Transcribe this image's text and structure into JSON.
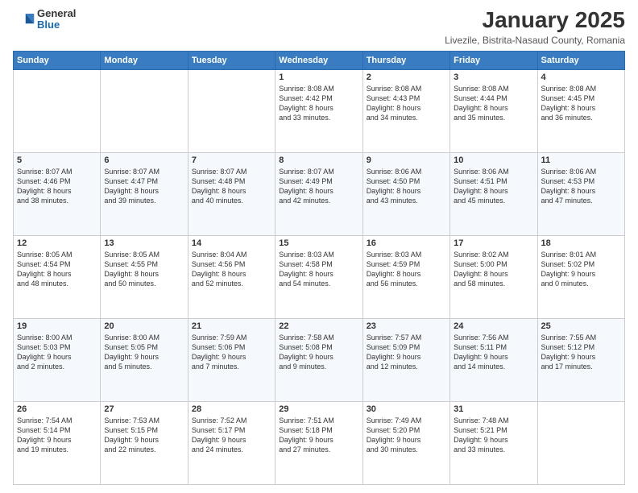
{
  "header": {
    "logo_general": "General",
    "logo_blue": "Blue",
    "month_title": "January 2025",
    "subtitle": "Livezile, Bistrita-Nasaud County, Romania"
  },
  "calendar": {
    "weekdays": [
      "Sunday",
      "Monday",
      "Tuesday",
      "Wednesday",
      "Thursday",
      "Friday",
      "Saturday"
    ],
    "weeks": [
      [
        {
          "day": "",
          "info": ""
        },
        {
          "day": "",
          "info": ""
        },
        {
          "day": "",
          "info": ""
        },
        {
          "day": "1",
          "info": "Sunrise: 8:08 AM\nSunset: 4:42 PM\nDaylight: 8 hours\nand 33 minutes."
        },
        {
          "day": "2",
          "info": "Sunrise: 8:08 AM\nSunset: 4:43 PM\nDaylight: 8 hours\nand 34 minutes."
        },
        {
          "day": "3",
          "info": "Sunrise: 8:08 AM\nSunset: 4:44 PM\nDaylight: 8 hours\nand 35 minutes."
        },
        {
          "day": "4",
          "info": "Sunrise: 8:08 AM\nSunset: 4:45 PM\nDaylight: 8 hours\nand 36 minutes."
        }
      ],
      [
        {
          "day": "5",
          "info": "Sunrise: 8:07 AM\nSunset: 4:46 PM\nDaylight: 8 hours\nand 38 minutes."
        },
        {
          "day": "6",
          "info": "Sunrise: 8:07 AM\nSunset: 4:47 PM\nDaylight: 8 hours\nand 39 minutes."
        },
        {
          "day": "7",
          "info": "Sunrise: 8:07 AM\nSunset: 4:48 PM\nDaylight: 8 hours\nand 40 minutes."
        },
        {
          "day": "8",
          "info": "Sunrise: 8:07 AM\nSunset: 4:49 PM\nDaylight: 8 hours\nand 42 minutes."
        },
        {
          "day": "9",
          "info": "Sunrise: 8:06 AM\nSunset: 4:50 PM\nDaylight: 8 hours\nand 43 minutes."
        },
        {
          "day": "10",
          "info": "Sunrise: 8:06 AM\nSunset: 4:51 PM\nDaylight: 8 hours\nand 45 minutes."
        },
        {
          "day": "11",
          "info": "Sunrise: 8:06 AM\nSunset: 4:53 PM\nDaylight: 8 hours\nand 47 minutes."
        }
      ],
      [
        {
          "day": "12",
          "info": "Sunrise: 8:05 AM\nSunset: 4:54 PM\nDaylight: 8 hours\nand 48 minutes."
        },
        {
          "day": "13",
          "info": "Sunrise: 8:05 AM\nSunset: 4:55 PM\nDaylight: 8 hours\nand 50 minutes."
        },
        {
          "day": "14",
          "info": "Sunrise: 8:04 AM\nSunset: 4:56 PM\nDaylight: 8 hours\nand 52 minutes."
        },
        {
          "day": "15",
          "info": "Sunrise: 8:03 AM\nSunset: 4:58 PM\nDaylight: 8 hours\nand 54 minutes."
        },
        {
          "day": "16",
          "info": "Sunrise: 8:03 AM\nSunset: 4:59 PM\nDaylight: 8 hours\nand 56 minutes."
        },
        {
          "day": "17",
          "info": "Sunrise: 8:02 AM\nSunset: 5:00 PM\nDaylight: 8 hours\nand 58 minutes."
        },
        {
          "day": "18",
          "info": "Sunrise: 8:01 AM\nSunset: 5:02 PM\nDaylight: 9 hours\nand 0 minutes."
        }
      ],
      [
        {
          "day": "19",
          "info": "Sunrise: 8:00 AM\nSunset: 5:03 PM\nDaylight: 9 hours\nand 2 minutes."
        },
        {
          "day": "20",
          "info": "Sunrise: 8:00 AM\nSunset: 5:05 PM\nDaylight: 9 hours\nand 5 minutes."
        },
        {
          "day": "21",
          "info": "Sunrise: 7:59 AM\nSunset: 5:06 PM\nDaylight: 9 hours\nand 7 minutes."
        },
        {
          "day": "22",
          "info": "Sunrise: 7:58 AM\nSunset: 5:08 PM\nDaylight: 9 hours\nand 9 minutes."
        },
        {
          "day": "23",
          "info": "Sunrise: 7:57 AM\nSunset: 5:09 PM\nDaylight: 9 hours\nand 12 minutes."
        },
        {
          "day": "24",
          "info": "Sunrise: 7:56 AM\nSunset: 5:11 PM\nDaylight: 9 hours\nand 14 minutes."
        },
        {
          "day": "25",
          "info": "Sunrise: 7:55 AM\nSunset: 5:12 PM\nDaylight: 9 hours\nand 17 minutes."
        }
      ],
      [
        {
          "day": "26",
          "info": "Sunrise: 7:54 AM\nSunset: 5:14 PM\nDaylight: 9 hours\nand 19 minutes."
        },
        {
          "day": "27",
          "info": "Sunrise: 7:53 AM\nSunset: 5:15 PM\nDaylight: 9 hours\nand 22 minutes."
        },
        {
          "day": "28",
          "info": "Sunrise: 7:52 AM\nSunset: 5:17 PM\nDaylight: 9 hours\nand 24 minutes."
        },
        {
          "day": "29",
          "info": "Sunrise: 7:51 AM\nSunset: 5:18 PM\nDaylight: 9 hours\nand 27 minutes."
        },
        {
          "day": "30",
          "info": "Sunrise: 7:49 AM\nSunset: 5:20 PM\nDaylight: 9 hours\nand 30 minutes."
        },
        {
          "day": "31",
          "info": "Sunrise: 7:48 AM\nSunset: 5:21 PM\nDaylight: 9 hours\nand 33 minutes."
        },
        {
          "day": "",
          "info": ""
        }
      ]
    ]
  }
}
